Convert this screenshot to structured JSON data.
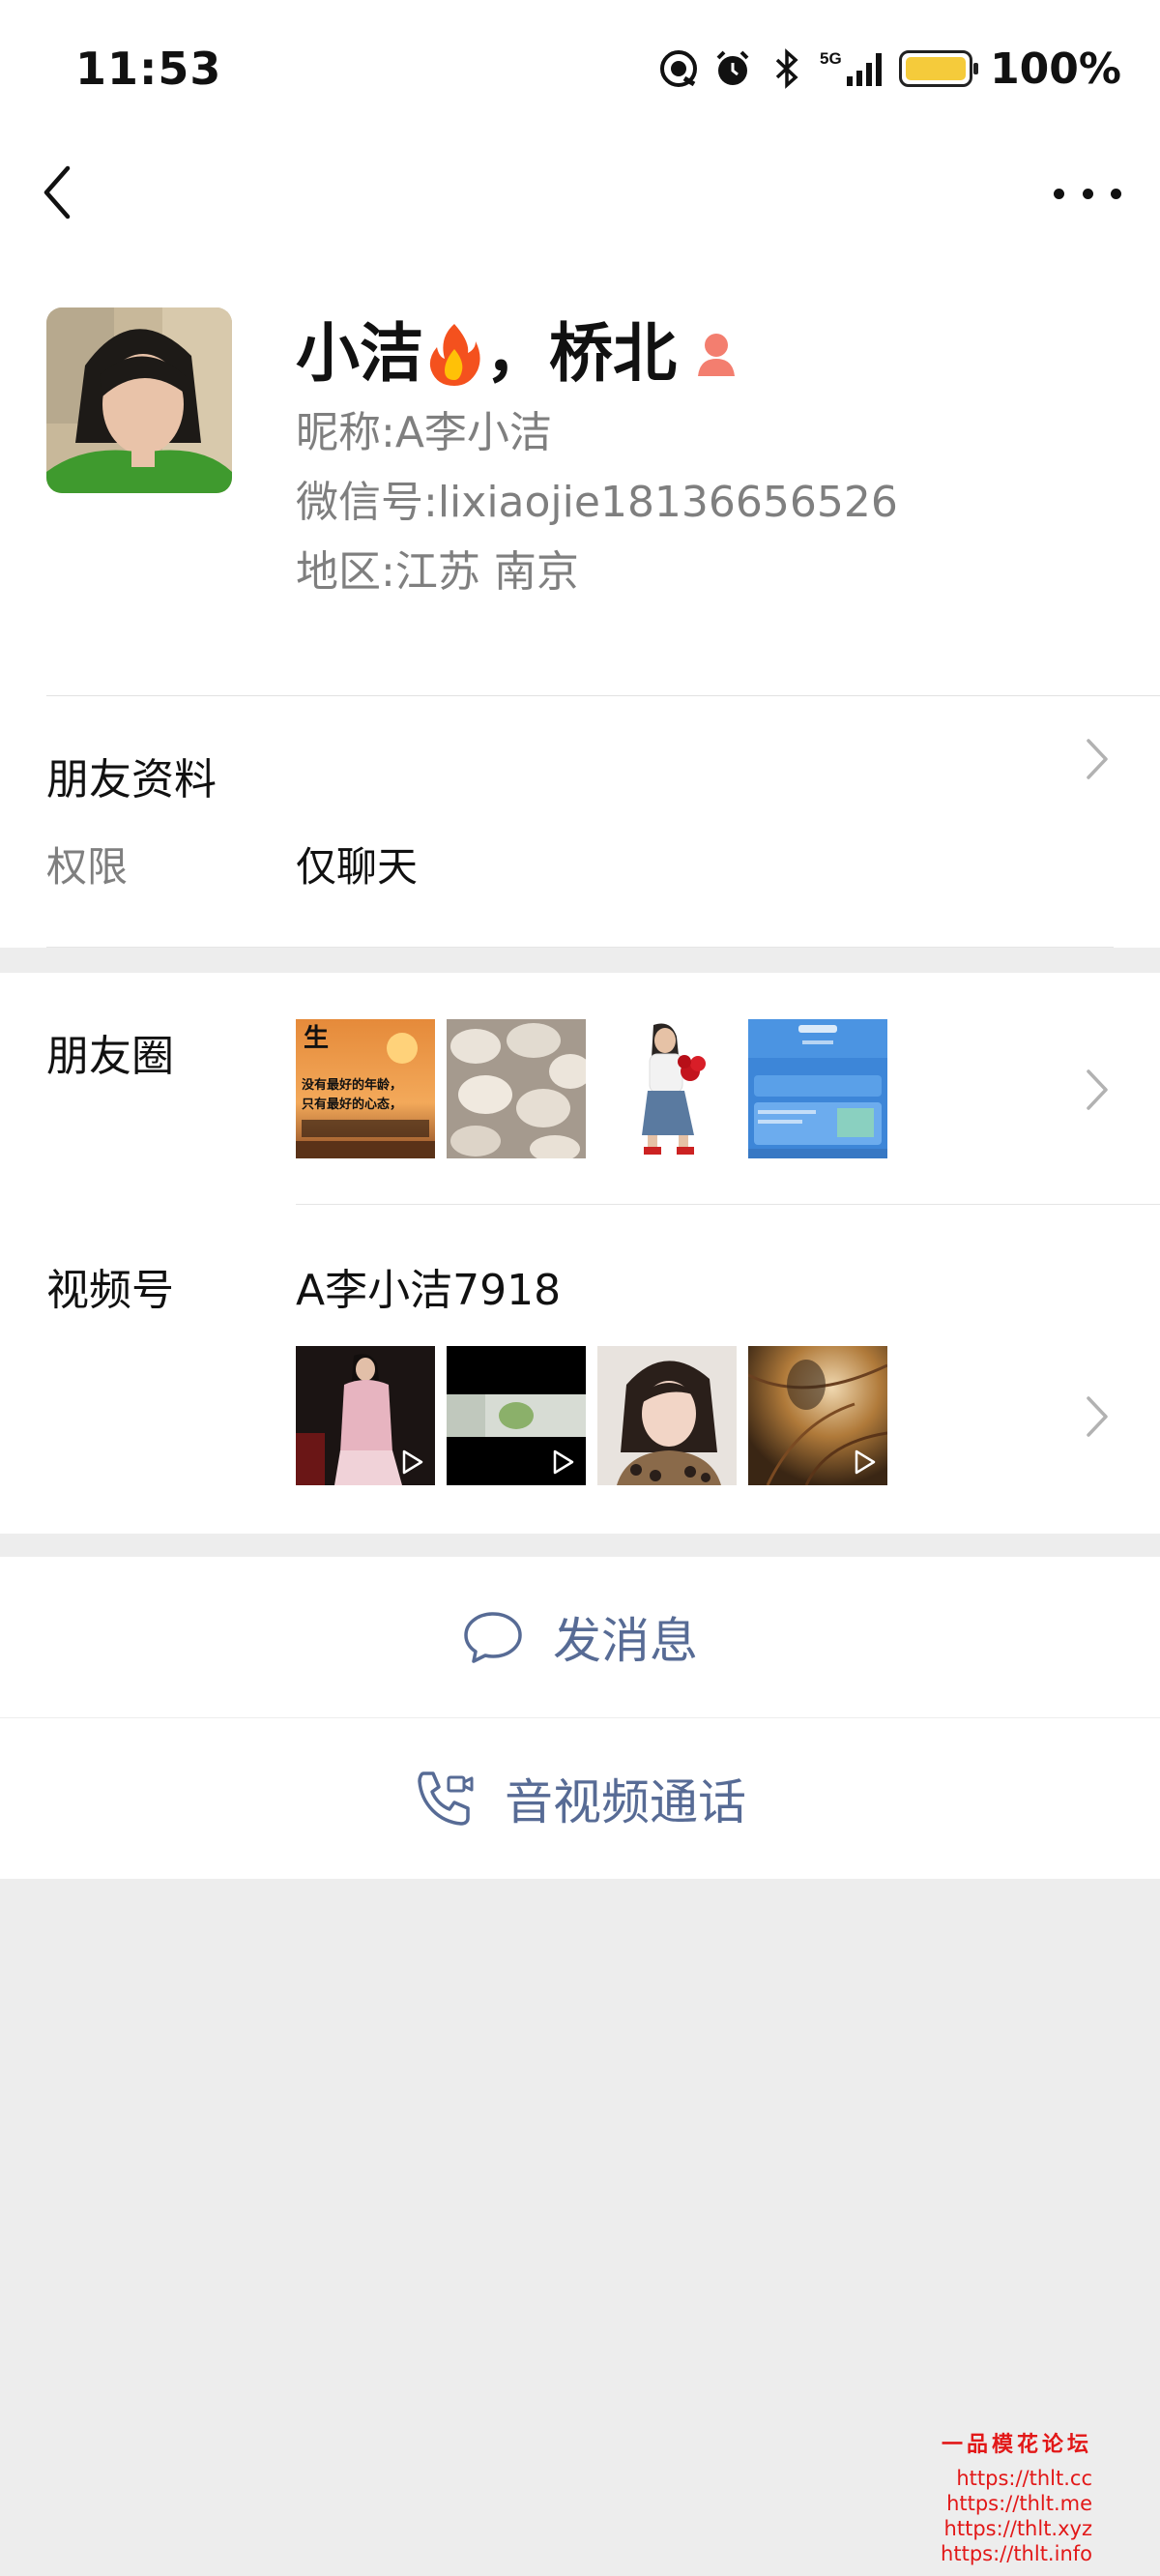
{
  "status_bar": {
    "time": "11:53",
    "network": "5G",
    "battery": "100%",
    "icons": [
      "hotspot-icon",
      "alarm-icon",
      "bluetooth-icon",
      "signal-icon",
      "battery-icon"
    ]
  },
  "nav": {
    "back_icon": "chevron-left-icon",
    "more_icon": "more-dots-icon"
  },
  "profile": {
    "display_name_part1": "小洁",
    "display_name_part2": "，桥北",
    "nickname_label": "昵称:",
    "nickname": "A李小洁",
    "wechat_id_label": "微信号:",
    "wechat_id": "lixiaojie18136656526",
    "region_label": "地区:",
    "region": "江苏  南京"
  },
  "friend_info": {
    "title": "朋友资料",
    "permission_label": "权限",
    "permission_value": "仅聊天"
  },
  "moments": {
    "title": "朋友圈",
    "thumb1_lines": [
      "生",
      "没有最好的年龄，",
      "只有最好的心态，"
    ]
  },
  "channels": {
    "title": "视频号",
    "name": "A李小洁7918"
  },
  "actions": {
    "message": "发消息",
    "call": "音视频通话"
  },
  "watermark": {
    "title": "一品模花论坛",
    "links": [
      "https://thlt.cc",
      "https://thlt.me",
      "https://thlt.xyz",
      "https://thlt.info"
    ]
  },
  "colors": {
    "link_blue": "#576b95",
    "page_bg": "#ededed",
    "watermark_red": "#e21818"
  }
}
